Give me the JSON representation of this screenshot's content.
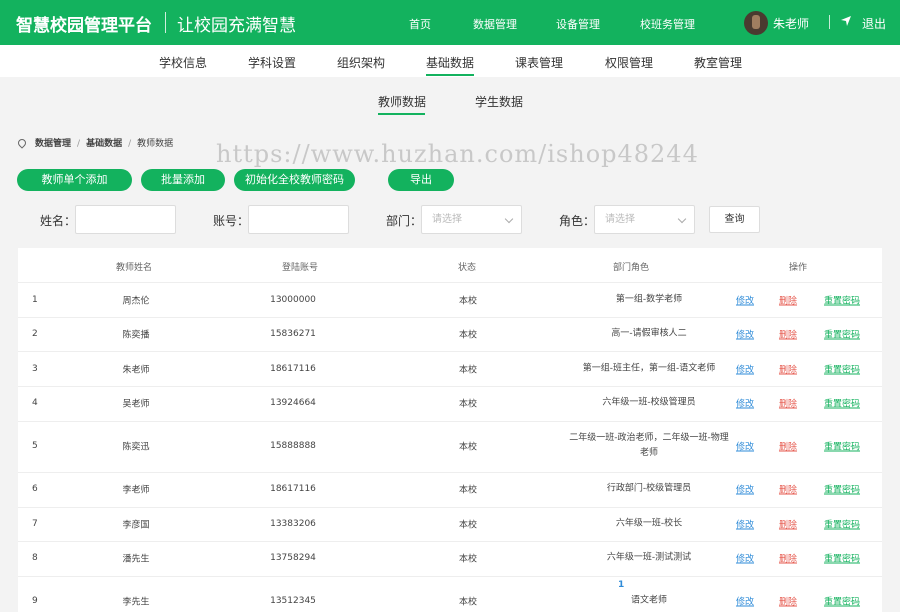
{
  "header": {
    "title": "智慧校园管理平台",
    "slogan": "让校园充满智慧",
    "nav": [
      "首页",
      "数据管理",
      "设备管理",
      "校班务管理"
    ],
    "user": "朱老师",
    "logout": "退出"
  },
  "subnav": [
    "学校信息",
    "学科设置",
    "组织架构",
    "基础数据",
    "课表管理",
    "权限管理",
    "教室管理"
  ],
  "tabs": [
    "教师数据",
    "学生数据"
  ],
  "breadcrumb": [
    "数据管理",
    "基础数据",
    "教师数据"
  ],
  "watermark": "https://www.huzhan.com/ishop48244",
  "buttons": [
    "教师单个添加",
    "批量添加",
    "初始化全校教师密码",
    "导出"
  ],
  "filters": {
    "name_label": "姓名：",
    "account_label": "账号：",
    "dept_label": "部门：",
    "dept_placeholder": "请选择",
    "role_label": "角色：",
    "role_placeholder": "请选择",
    "query": "查询"
  },
  "table": {
    "headers": [
      "教师姓名",
      "登陆账号",
      "状态",
      "部门角色",
      "操作"
    ],
    "actions": {
      "edit": "修改",
      "delete": "删除",
      "reset": "重置密码"
    },
    "rows": [
      {
        "no": "1",
        "name": "周杰伦",
        "account": "13000000",
        "status": "本校",
        "role": "第一组-数学老师"
      },
      {
        "no": "2",
        "name": "陈奕播",
        "account": "15836271",
        "status": "本校",
        "role": "高一-请假审核人二"
      },
      {
        "no": "3",
        "name": "朱老师",
        "account": "18617116",
        "status": "本校",
        "role": "第一组-班主任，第一组-语文老师"
      },
      {
        "no": "4",
        "name": "吴老师",
        "account": "13924664",
        "status": "本校",
        "role": "六年级一班-校级管理员"
      },
      {
        "no": "5",
        "name": "陈奕迅",
        "account": "15888888",
        "status": "本校",
        "role": "二年级一班-政治老师，二年级一班-物理老师"
      },
      {
        "no": "6",
        "name": "李老师",
        "account": "18617116",
        "status": "本校",
        "role": "行政部门-校级管理员"
      },
      {
        "no": "7",
        "name": "李彦国",
        "account": "13383206",
        "status": "本校",
        "role": "六年级一班-校长"
      },
      {
        "no": "8",
        "name": "潘先生",
        "account": "13758294",
        "status": "本校",
        "role": "六年级一班-测试测试"
      },
      {
        "no": "9",
        "name": "李先生",
        "account": "13512345",
        "status": "本校",
        "role": "语文老师"
      }
    ]
  },
  "pagination": {
    "current": "1"
  }
}
